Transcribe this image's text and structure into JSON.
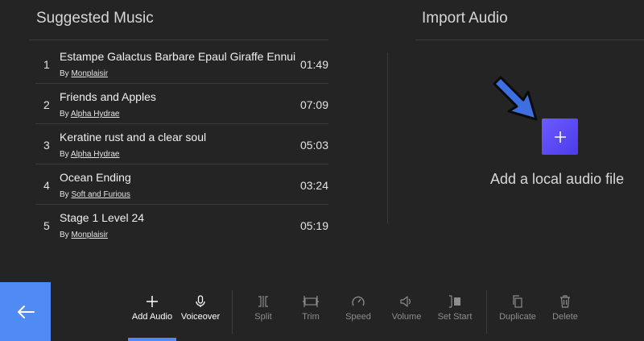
{
  "suggested": {
    "title": "Suggested Music",
    "by_prefix": "By",
    "tracks": [
      {
        "index": "1",
        "title": "Estampe Galactus Barbare Epaul Giraffe Ennui",
        "artist": "Monplaisir",
        "duration": "01:49"
      },
      {
        "index": "2",
        "title": "Friends and Apples",
        "artist": "Alpha Hydrae",
        "duration": "07:09"
      },
      {
        "index": "3",
        "title": "Keratine rust and a clear soul",
        "artist": "Alpha Hydrae",
        "duration": "05:03"
      },
      {
        "index": "4",
        "title": "Ocean Ending",
        "artist": "Soft and Furious",
        "duration": "03:24"
      },
      {
        "index": "5",
        "title": "Stage 1 Level 24",
        "artist": "Monplaisir",
        "duration": "05:19"
      }
    ]
  },
  "import": {
    "title": "Import Audio",
    "label": "Add a local audio file",
    "button_icon": "plus-icon",
    "arrow_icon": "arrow-down-right-icon"
  },
  "toolbar": {
    "back_icon": "arrow-left-icon",
    "items": [
      {
        "label": "Add Audio",
        "icon": "plus-icon",
        "enabled": true,
        "active": true
      },
      {
        "label": "Voiceover",
        "icon": "microphone-icon",
        "enabled": true
      },
      {
        "label": "Split",
        "icon": "split-icon",
        "enabled": false
      },
      {
        "label": "Trim",
        "icon": "trim-icon",
        "enabled": false
      },
      {
        "label": "Speed",
        "icon": "speedometer-icon",
        "enabled": false
      },
      {
        "label": "Volume",
        "icon": "speaker-icon",
        "enabled": false
      },
      {
        "label": "Set Start",
        "icon": "set-start-icon",
        "enabled": false
      },
      {
        "label": "Duplicate",
        "icon": "copy-icon",
        "enabled": false
      },
      {
        "label": "Delete",
        "icon": "trash-icon",
        "enabled": false
      }
    ]
  },
  "colors": {
    "background": "#242424",
    "accent": "#4f8bf3",
    "import_button": "#5a48f5",
    "disabled_text": "#8d8d8d"
  }
}
